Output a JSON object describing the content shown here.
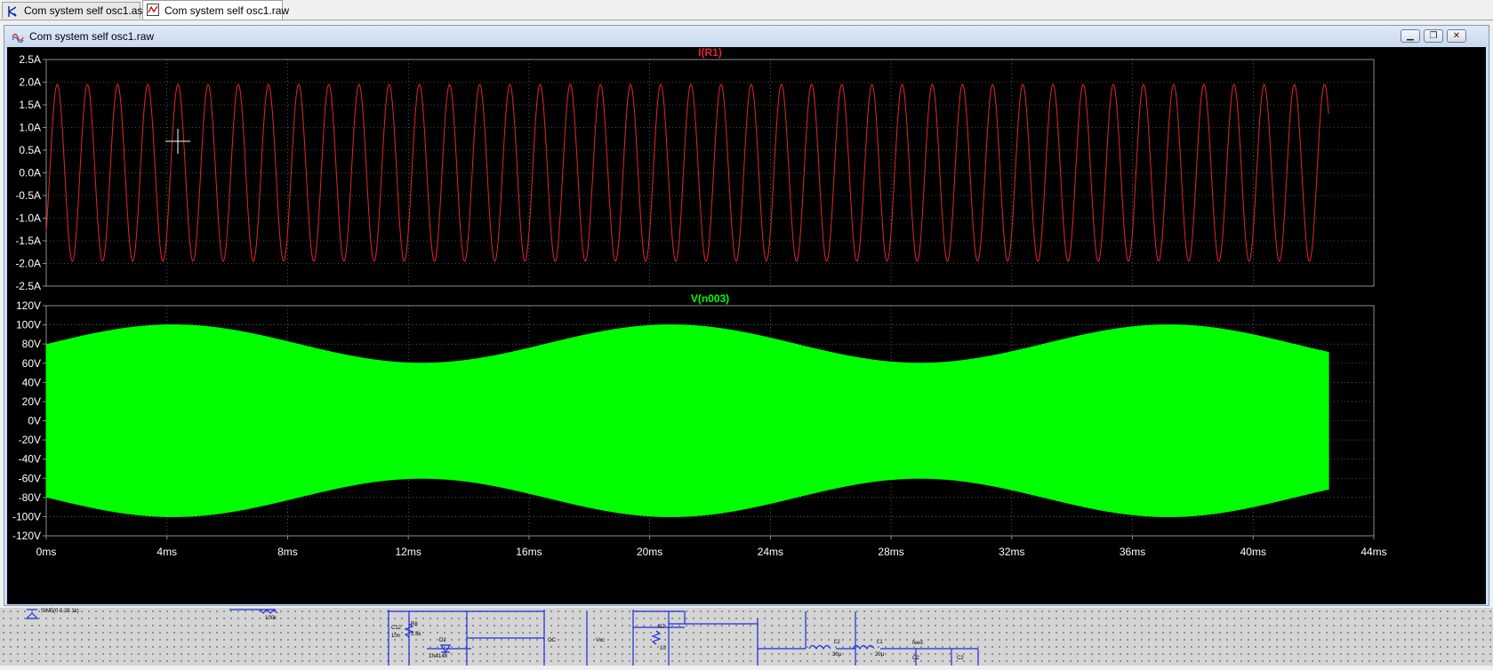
{
  "tabs": [
    {
      "label": "Com system self osc1.asc",
      "icon": "schematic-icon",
      "active": false
    },
    {
      "label": "Com system self osc1.raw",
      "icon": "waveform-icon",
      "active": true
    }
  ],
  "window": {
    "title": "Com system self osc1.raw",
    "icon": "waveform-icon",
    "buttons": {
      "minimize": "▁",
      "restore": "❐",
      "close": "✕"
    }
  },
  "colors": {
    "plot_bg": "#000000",
    "trace1": "#e0282d",
    "trace2": "#00ff00",
    "axis_text": "#ffffff",
    "grid": "#8c8c8c"
  },
  "chart_data": [
    {
      "type": "line",
      "title": "I(R1)",
      "series": [
        {
          "name": "I(R1)",
          "frequency_hz": 1000,
          "amplitude": 1.95,
          "offset": 0.0,
          "start_value": -1.3,
          "end_value": 1.3
        }
      ],
      "x_ticks": [
        "0ms",
        "4ms",
        "8ms",
        "12ms",
        "16ms",
        "20ms",
        "24ms",
        "28ms",
        "32ms",
        "36ms",
        "40ms",
        "44ms"
      ],
      "xlim": [
        0,
        44
      ],
      "x_data_end": 42.5,
      "y_ticks": [
        "2.5A",
        "2.0A",
        "1.5A",
        "1.0A",
        "0.5A",
        "0.0A",
        "-0.5A",
        "-1.0A",
        "-1.5A",
        "-2.0A",
        "-2.5A"
      ],
      "ylim": [
        -2.5,
        2.5
      ],
      "grid": true
    },
    {
      "type": "area",
      "title": "V(n003)",
      "series": [
        {
          "name": "V(n003)",
          "envelope_upper": {
            "mean": 80,
            "amplitude": 20,
            "period_ms": 16.5,
            "peak_ms": 4.2
          },
          "envelope_lower": {
            "mean": -80,
            "amplitude": 20,
            "period_ms": 16.5,
            "peak_ms": 4.2
          }
        }
      ],
      "x_ticks": [
        "0ms",
        "4ms",
        "8ms",
        "12ms",
        "16ms",
        "20ms",
        "24ms",
        "28ms",
        "32ms",
        "36ms",
        "40ms",
        "44ms"
      ],
      "xlim": [
        0,
        44
      ],
      "x_data_end": 42.5,
      "y_ticks": [
        "120V",
        "100V",
        "80V",
        "60V",
        "40V",
        "20V",
        "0V",
        "-20V",
        "-40V",
        "-60V",
        "-80V",
        "-100V",
        "-120V"
      ],
      "ylim": [
        -120,
        120
      ],
      "grid": true
    }
  ],
  "schematic_labels": [
    "SINE(0 0.25 1k)",
    "100k",
    "C12",
    "10n",
    "R8",
    "3.3k",
    "D2",
    "1N4148",
    "OC",
    "Vcc",
    "R7",
    "10",
    "L2",
    "30µ",
    "L1",
    "20µ",
    "feed",
    "C2",
    "C2"
  ]
}
